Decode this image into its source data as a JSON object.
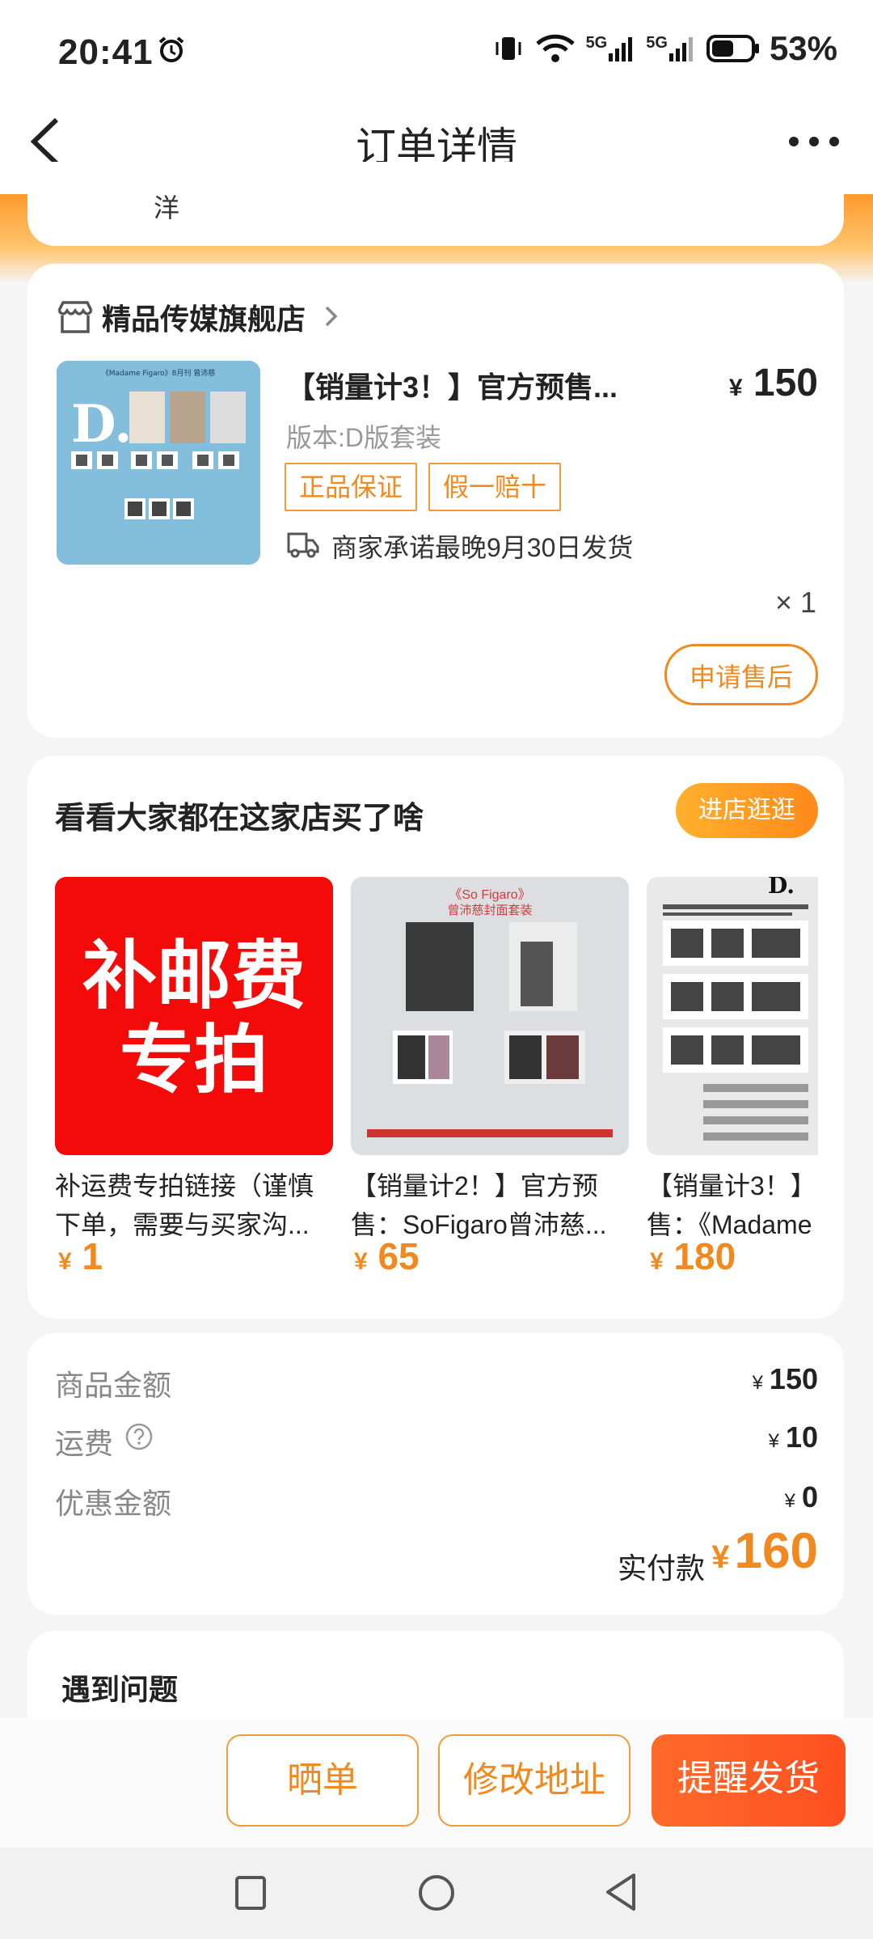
{
  "status_bar": {
    "time": "20:41",
    "network1": "5G",
    "network2": "5G",
    "battery": "53%"
  },
  "header": {
    "title": "订单详情"
  },
  "top_card": {
    "address_tail": "洋"
  },
  "shop": {
    "name": "精品传媒旗舰店",
    "product": {
      "name": "【销量计3！】官方预售...",
      "price": "150",
      "currency": "¥",
      "variant": "版本:D版套装",
      "tags": [
        "正品保证",
        "假一赔十"
      ],
      "shipping": "商家承诺最晚9月30日发货",
      "quantity": "× 1"
    },
    "after_sales_label": "申请售后"
  },
  "recommend": {
    "title": "看看大家都在这家店买了啥",
    "store_button": "进店逛逛",
    "items": [
      {
        "image_text_line1": "补邮费",
        "image_text_line2": "专拍",
        "name_line1": "补运费专拍链接（谨慎",
        "name_line2": "下单，需要与买家沟...",
        "price": "1"
      },
      {
        "image_title": "《So Figaro》",
        "image_subtitle": "曾沛慈封面套装",
        "name_line1": "【销量计2！】官方预",
        "name_line2": "售：SoFigaro曾沛慈...",
        "price": "65"
      },
      {
        "image_letter": "D.",
        "name_line1": "【销量计3！】",
        "name_line2": "售：《Madame",
        "price": "180"
      }
    ]
  },
  "totals": {
    "goods_label": "商品金额",
    "goods_value": "150",
    "shipping_label": "运费",
    "shipping_value": "10",
    "discount_label": "优惠金额",
    "discount_value": "0",
    "paid_label": "实付款",
    "paid_value": "160",
    "currency": "¥"
  },
  "problem": {
    "title": "遇到问题"
  },
  "bottom_actions": {
    "show": "晒单",
    "change_address": "修改地址",
    "remind": "提醒发货"
  },
  "product_image_text": {
    "letter": "D.",
    "line1": "《Madame Figaro》8月刊 曾沛慈"
  },
  "colors": {
    "accent": "#f08a20",
    "remind_button": "#ff5a22",
    "price_red": "#ff0000"
  }
}
